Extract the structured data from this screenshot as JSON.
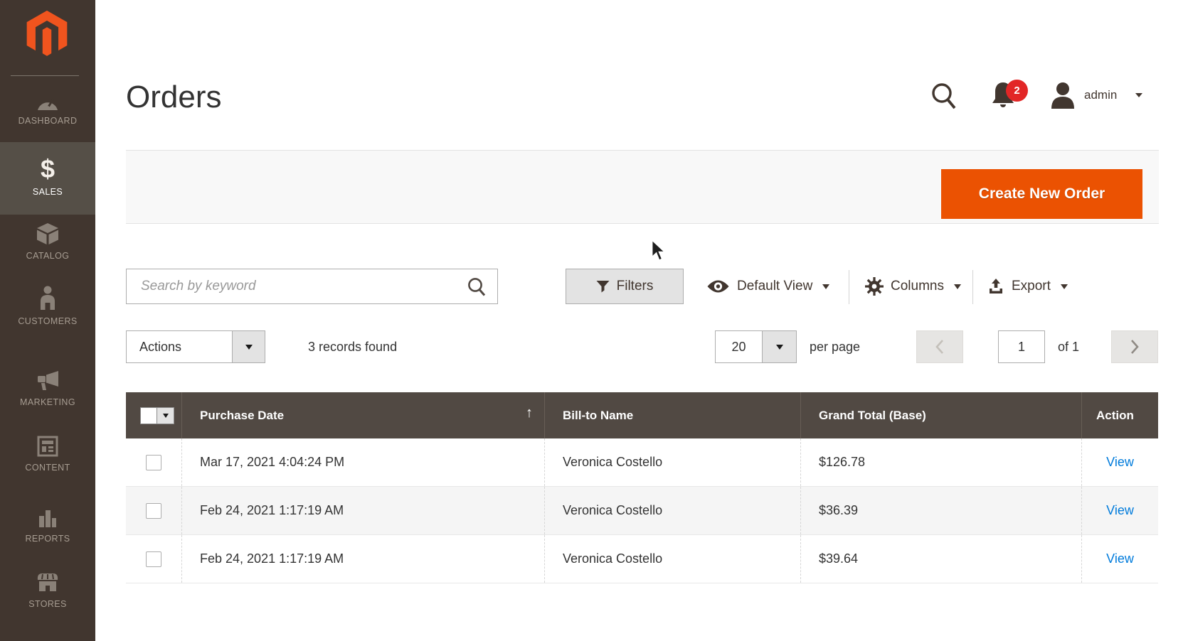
{
  "colors": {
    "accent": "#eb5202",
    "link": "#007bdb",
    "badge": "#e22626",
    "sidebar_bg": "#41362f",
    "sidebar_active_bg": "#554f47",
    "grid_header_bg": "#514943",
    "band_bg": "#f8f8f8"
  },
  "sidebar": {
    "logo_icon": "magento-logo",
    "items": [
      {
        "label": "DASHBOARD",
        "icon": "dashboard-gauge-icon",
        "active": false
      },
      {
        "label": "SALES",
        "icon": "dollar-icon",
        "active": true
      },
      {
        "label": "CATALOG",
        "icon": "box-icon",
        "active": false
      },
      {
        "label": "CUSTOMERS",
        "icon": "person-icon",
        "active": false
      },
      {
        "label": "MARKETING",
        "icon": "megaphone-icon",
        "active": false
      },
      {
        "label": "CONTENT",
        "icon": "layout-icon",
        "active": false
      },
      {
        "label": "REPORTS",
        "icon": "bar-chart-icon",
        "active": false
      },
      {
        "label": "STORES",
        "icon": "storefront-icon",
        "active": false
      }
    ]
  },
  "header": {
    "title": "Orders",
    "search_icon": "search-icon",
    "notifications": {
      "icon": "bell-icon",
      "count": "2"
    },
    "user": {
      "icon": "user-icon",
      "name": "admin"
    }
  },
  "band": {
    "create_button_label": "Create New Order"
  },
  "toolbar": {
    "search_placeholder": "Search by keyword",
    "search_value": "",
    "filters_label": "Filters",
    "default_view_label": "Default View",
    "columns_label": "Columns",
    "export_label": "Export"
  },
  "actions_row": {
    "actions_label": "Actions",
    "records_text": "3 records found",
    "per_page_value": "20",
    "per_page_label": "per page",
    "page_value": "1",
    "page_of": "of 1"
  },
  "table": {
    "sort_indicator": "↑",
    "headers": [
      "Purchase Date",
      "Bill-to Name",
      "Grand Total (Base)",
      "Action"
    ],
    "rows": [
      {
        "date": "Mar 17, 2021 4:04:24 PM",
        "name": "Veronica Costello",
        "total": "$126.78",
        "action": "View"
      },
      {
        "date": "Feb 24, 2021 1:17:19 AM",
        "name": "Veronica Costello",
        "total": "$36.39",
        "action": "View"
      },
      {
        "date": "Feb 24, 2021 1:17:19 AM",
        "name": "Veronica Costello",
        "total": "$39.64",
        "action": "View"
      }
    ]
  }
}
